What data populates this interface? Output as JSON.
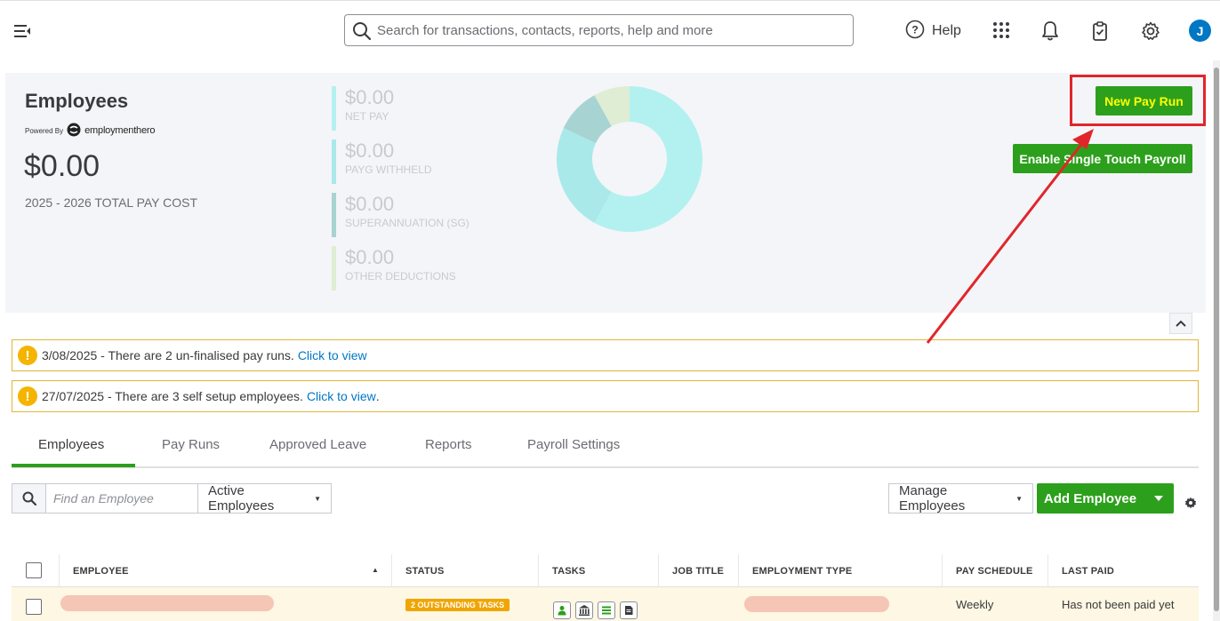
{
  "header": {
    "search_placeholder": "Search for transactions, contacts, reports, help and more",
    "help_label": "Help",
    "avatar_initial": "J",
    "icons": [
      "menu-toggle-icon",
      "search-icon",
      "help-icon",
      "apps-grid-icon",
      "bell-icon",
      "clipboard-check-icon",
      "gear-icon"
    ]
  },
  "summary": {
    "title": "Employees",
    "powered_by": "Powered By",
    "powered_brand": "employmenthero",
    "total_cost": "$0.00",
    "total_label": "2025 - 2026 TOTAL PAY COST",
    "metrics": [
      {
        "value": "$0.00",
        "label": "NET PAY",
        "color": "#b3f1f0"
      },
      {
        "value": "$0.00",
        "label": "PAYG WITHHELD",
        "color": "#a9e9ea"
      },
      {
        "value": "$0.00",
        "label": "SUPERANNUATION (SG)",
        "color": "#a8d3d3"
      },
      {
        "value": "$0.00",
        "label": "OTHER DEDUCTIONS",
        "color": "#deedd3"
      }
    ],
    "donut_segments": [
      {
        "name": "net-pay",
        "fraction": 0.58,
        "color": "#b3f1f0"
      },
      {
        "name": "payg-withheld",
        "fraction": 0.24,
        "color": "#a9e9ea"
      },
      {
        "name": "superannuation",
        "fraction": 0.1,
        "color": "#a8d3d3"
      },
      {
        "name": "other-deductions",
        "fraction": 0.08,
        "color": "#deedd3"
      }
    ],
    "new_pay_run_label": "New Pay Run",
    "stp_label": "Enable Single Touch Payroll"
  },
  "alerts": [
    {
      "text": "3/08/2025 - There are 2 un-finalised pay runs.",
      "link": "Click to view",
      "suffix": ""
    },
    {
      "text": "27/07/2025 - There are 3 self setup employees.",
      "link": "Click to view",
      "suffix": "."
    }
  ],
  "tabs": [
    "Employees",
    "Pay Runs",
    "Approved Leave",
    "Reports",
    "Payroll Settings"
  ],
  "toolbar": {
    "find_placeholder": "Find an Employee",
    "filter_label": "Active Employees",
    "manage_label": "Manage Employees",
    "add_label": "Add Employee"
  },
  "table": {
    "columns": [
      "EMPLOYEE",
      "STATUS",
      "TASKS",
      "JOB TITLE",
      "EMPLOYMENT TYPE",
      "PAY SCHEDULE",
      "LAST PAID"
    ],
    "rows": [
      {
        "status": "2 OUTSTANDING TASKS",
        "pay_schedule": "Weekly",
        "last_paid": "Has not been paid yet"
      }
    ]
  },
  "colors": {
    "accent_green": "#2ca01c",
    "highlight_red": "#e0262b",
    "link_blue": "#0077c5",
    "warning": "#f4b400"
  }
}
